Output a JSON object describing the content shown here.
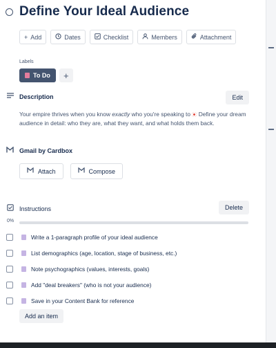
{
  "card": {
    "title": "Define Your Ideal Audience"
  },
  "actions": [
    {
      "label": "Add",
      "icon": "plus-icon"
    },
    {
      "label": "Dates",
      "icon": "clock-icon"
    },
    {
      "label": "Checklist",
      "icon": "checklist-icon"
    },
    {
      "label": "Members",
      "icon": "person-icon"
    },
    {
      "label": "Attachment",
      "icon": "paperclip-icon"
    }
  ],
  "labels": {
    "heading": "Labels",
    "items": [
      {
        "text": "To Do",
        "color": "#44546f"
      }
    ],
    "add_symbol": "+"
  },
  "description": {
    "heading": "Description",
    "edit_label": "Edit",
    "text_before": "Your empire thrives when you know ",
    "text_emph": "exactly",
    "text_mid": " who you're speaking to ",
    "text_after": " Define your dream audience in detail: who they are, what they want, and what holds them back."
  },
  "gmail": {
    "heading": "Gmail by Cardbox",
    "attach_label": "Attach",
    "compose_label": "Compose"
  },
  "checklist": {
    "heading": "Instructions",
    "delete_label": "Delete",
    "progress_text": "0%",
    "progress_fraction": 0,
    "items": [
      {
        "text": "Write a 1-paragraph profile of your ideal audience",
        "checked": false
      },
      {
        "text": "List demographics (age, location, stage of business, etc.)",
        "checked": false
      },
      {
        "text": "Note psychographics (values, interests, goals)",
        "checked": false
      },
      {
        "text": "Add \"deal breakers\" (who is not your audience)",
        "checked": false
      },
      {
        "text": "Save in your Content Bank for reference",
        "checked": false
      }
    ],
    "add_item_label": "Add an item"
  },
  "colors": {
    "accent_dark": "#44546f",
    "button_bg": "#f1f2f4",
    "text": "#172b4d"
  }
}
